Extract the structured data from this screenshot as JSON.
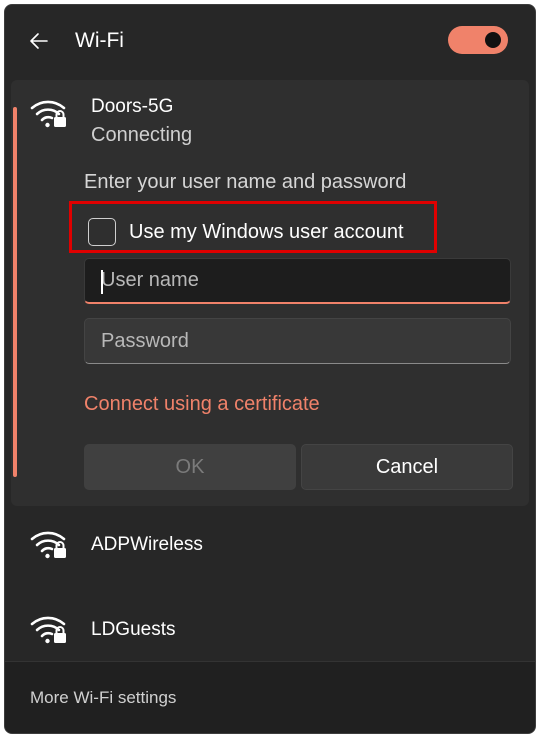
{
  "header": {
    "title": "Wi-Fi",
    "back_icon": "back-arrow-icon",
    "toggle_on": true,
    "accent_color": "#f0826a"
  },
  "expanded_network": {
    "name": "Doors-5G",
    "status": "Connecting",
    "icon": "wifi-secured-icon",
    "prompt": "Enter your user name and password",
    "checkbox": {
      "label": "Use my Windows user account",
      "checked": false
    },
    "username": {
      "value": "",
      "placeholder": "User name"
    },
    "password": {
      "value": "",
      "placeholder": "Password"
    },
    "certificate_link": "Connect using a certificate",
    "ok_label": "OK",
    "cancel_label": "Cancel"
  },
  "networks": [
    {
      "name": "ADPWireless",
      "icon": "wifi-secured-icon"
    },
    {
      "name": "LDGuests",
      "icon": "wifi-secured-icon"
    }
  ],
  "footer": {
    "link": "More Wi-Fi settings"
  },
  "highlight_color": "#e00000"
}
